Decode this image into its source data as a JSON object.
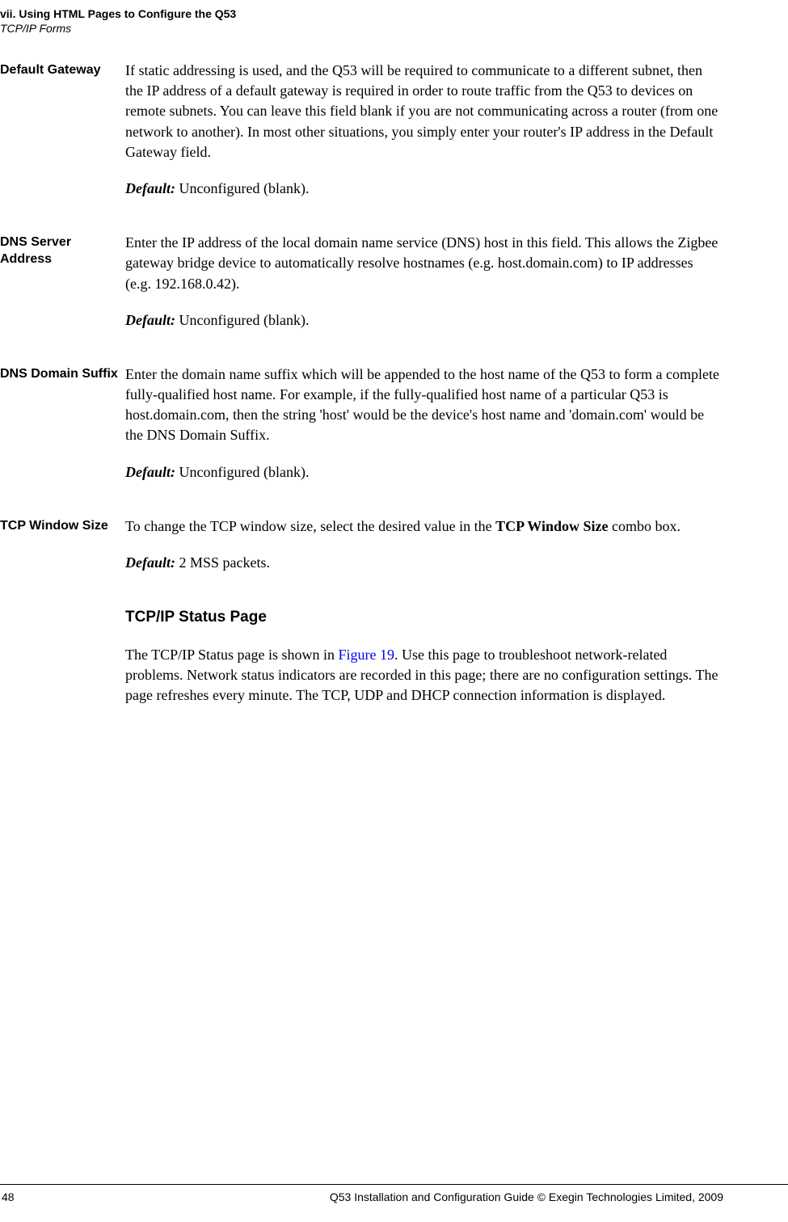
{
  "header": {
    "chapter": "vii. Using HTML Pages to Configure the Q53",
    "section": "TCP/IP Forms"
  },
  "sections": {
    "default_gateway": {
      "label": "Default Gateway",
      "body": "If static addressing is used, and the Q53 will be required to communicate to a different subnet, then the IP address of a default gateway is required in order to route traffic from the Q53 to devices on remote subnets. You can leave this field blank if you are not communicating across a router (from one network to another). In most other situations, you simply enter your router's IP address in the Default Gateway field.",
      "default_label": "Default:",
      "default_value": " Unconfigured (blank)."
    },
    "dns_server": {
      "label": "DNS Server Address",
      "body": "Enter the IP address of the local domain name service (DNS) host in this field. This allows the Zigbee gateway bridge device to automatically resolve hostnames (e.g. host.domain.com) to IP addresses (e.g. 192.168.0.42).",
      "default_label": "Default:",
      "default_value": " Unconfigured (blank)."
    },
    "dns_domain": {
      "label": "DNS Domain Suffix",
      "body": "Enter the domain name suffix which will be appended to the host name of the Q53 to form a complete fully-qualified host name. For example, if the fully-qualified host name of a particular Q53 is host.domain.com, then the string 'host' would be the device's host name and 'domain.com' would be the DNS Domain Suffix.",
      "default_label": "Default:",
      "default_value": " Unconfigured (blank)."
    },
    "tcp_window": {
      "label": "TCP Window Size",
      "body1": "To change the TCP window size, select the desired value in the ",
      "body_bold": "TCP Window Size",
      "body2": " combo box.",
      "default_label": "Default:",
      "default_value": " 2 MSS packets."
    },
    "status_page": {
      "heading": "TCP/IP Status Page",
      "body1": "The TCP/IP Status page is shown in ",
      "link": "Figure 19",
      "body2": ". Use this page to troubleshoot network-related problems. Network status indicators are recorded in this page; there are no configuration settings. The page refreshes every minute. The TCP, UDP and DHCP connection information is displayed."
    }
  },
  "footer": {
    "page_number": "48",
    "copyright": "Q53 Installation and Configuration Guide  © Exegin Technologies Limited, 2009"
  }
}
